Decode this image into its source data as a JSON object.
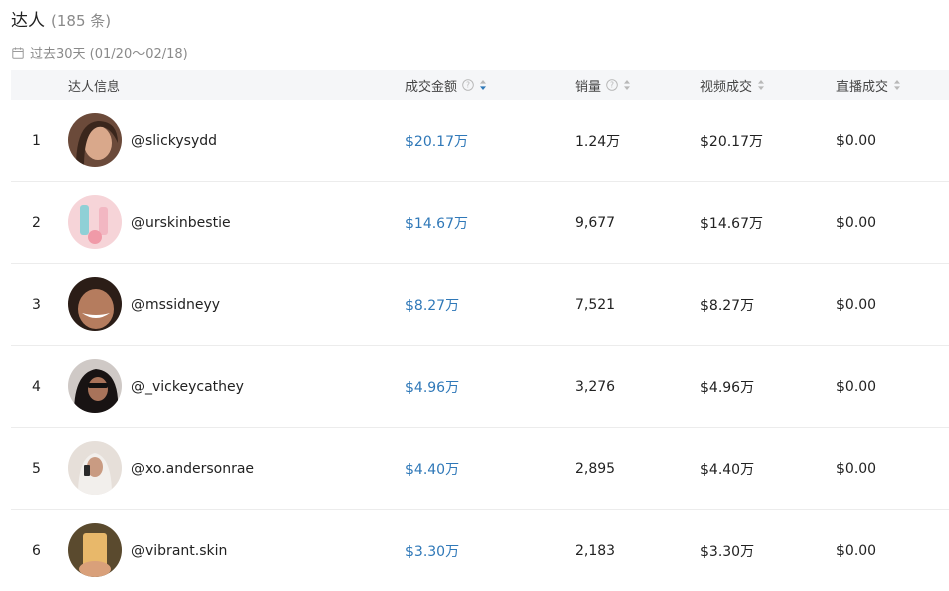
{
  "header": {
    "title": "达人",
    "count": "(185 条)",
    "date_range": "过去30天 (01/20～02/18)"
  },
  "columns": {
    "influencer": "达人信息",
    "gmv": "成交金额",
    "sales": "销量",
    "video_gmv": "视频成交",
    "live_gmv": "直播成交"
  },
  "rows": [
    {
      "rank": "1",
      "handle": "@slickysydd",
      "gmv": "$20.17万",
      "sales": "1.24万",
      "video_gmv": "$20.17万",
      "live_gmv": "$0.00"
    },
    {
      "rank": "2",
      "handle": "@urskinbestie",
      "gmv": "$14.67万",
      "sales": "9,677",
      "video_gmv": "$14.67万",
      "live_gmv": "$0.00"
    },
    {
      "rank": "3",
      "handle": "@mssidneyy",
      "gmv": "$8.27万",
      "sales": "7,521",
      "video_gmv": "$8.27万",
      "live_gmv": "$0.00"
    },
    {
      "rank": "4",
      "handle": "@_vickeycathey",
      "gmv": "$4.96万",
      "sales": "3,276",
      "video_gmv": "$4.96万",
      "live_gmv": "$0.00"
    },
    {
      "rank": "5",
      "handle": "@xo.andersonrae",
      "gmv": "$4.40万",
      "sales": "2,895",
      "video_gmv": "$4.40万",
      "live_gmv": "$0.00"
    },
    {
      "rank": "6",
      "handle": "@vibrant.skin",
      "gmv": "$3.30万",
      "sales": "2,183",
      "video_gmv": "$3.30万",
      "live_gmv": "$0.00"
    }
  ],
  "colors": {
    "accent_blue": "#2f78b8",
    "header_bg": "#f5f6f8",
    "muted_text": "#8a8a8a"
  }
}
